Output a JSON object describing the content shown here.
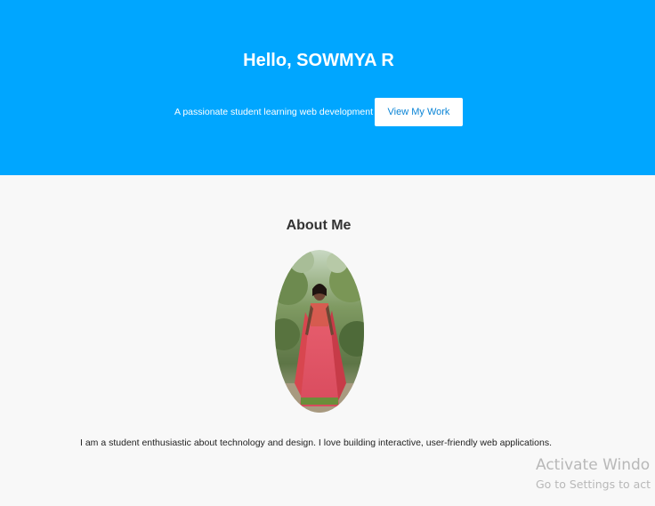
{
  "hero": {
    "title": "Hello, SOWMYA R",
    "tagline": "A passionate student learning web development",
    "button_label": "View My Work",
    "background_color": "#00a6ff"
  },
  "about": {
    "title": "About Me",
    "photo_alt": "Profile photo",
    "text": "I am a student enthusiastic about technology and design. I love building interactive, user-friendly web applications."
  },
  "os_watermark": {
    "title": "Activate Windo",
    "subtitle": "Go to Settings to act"
  }
}
